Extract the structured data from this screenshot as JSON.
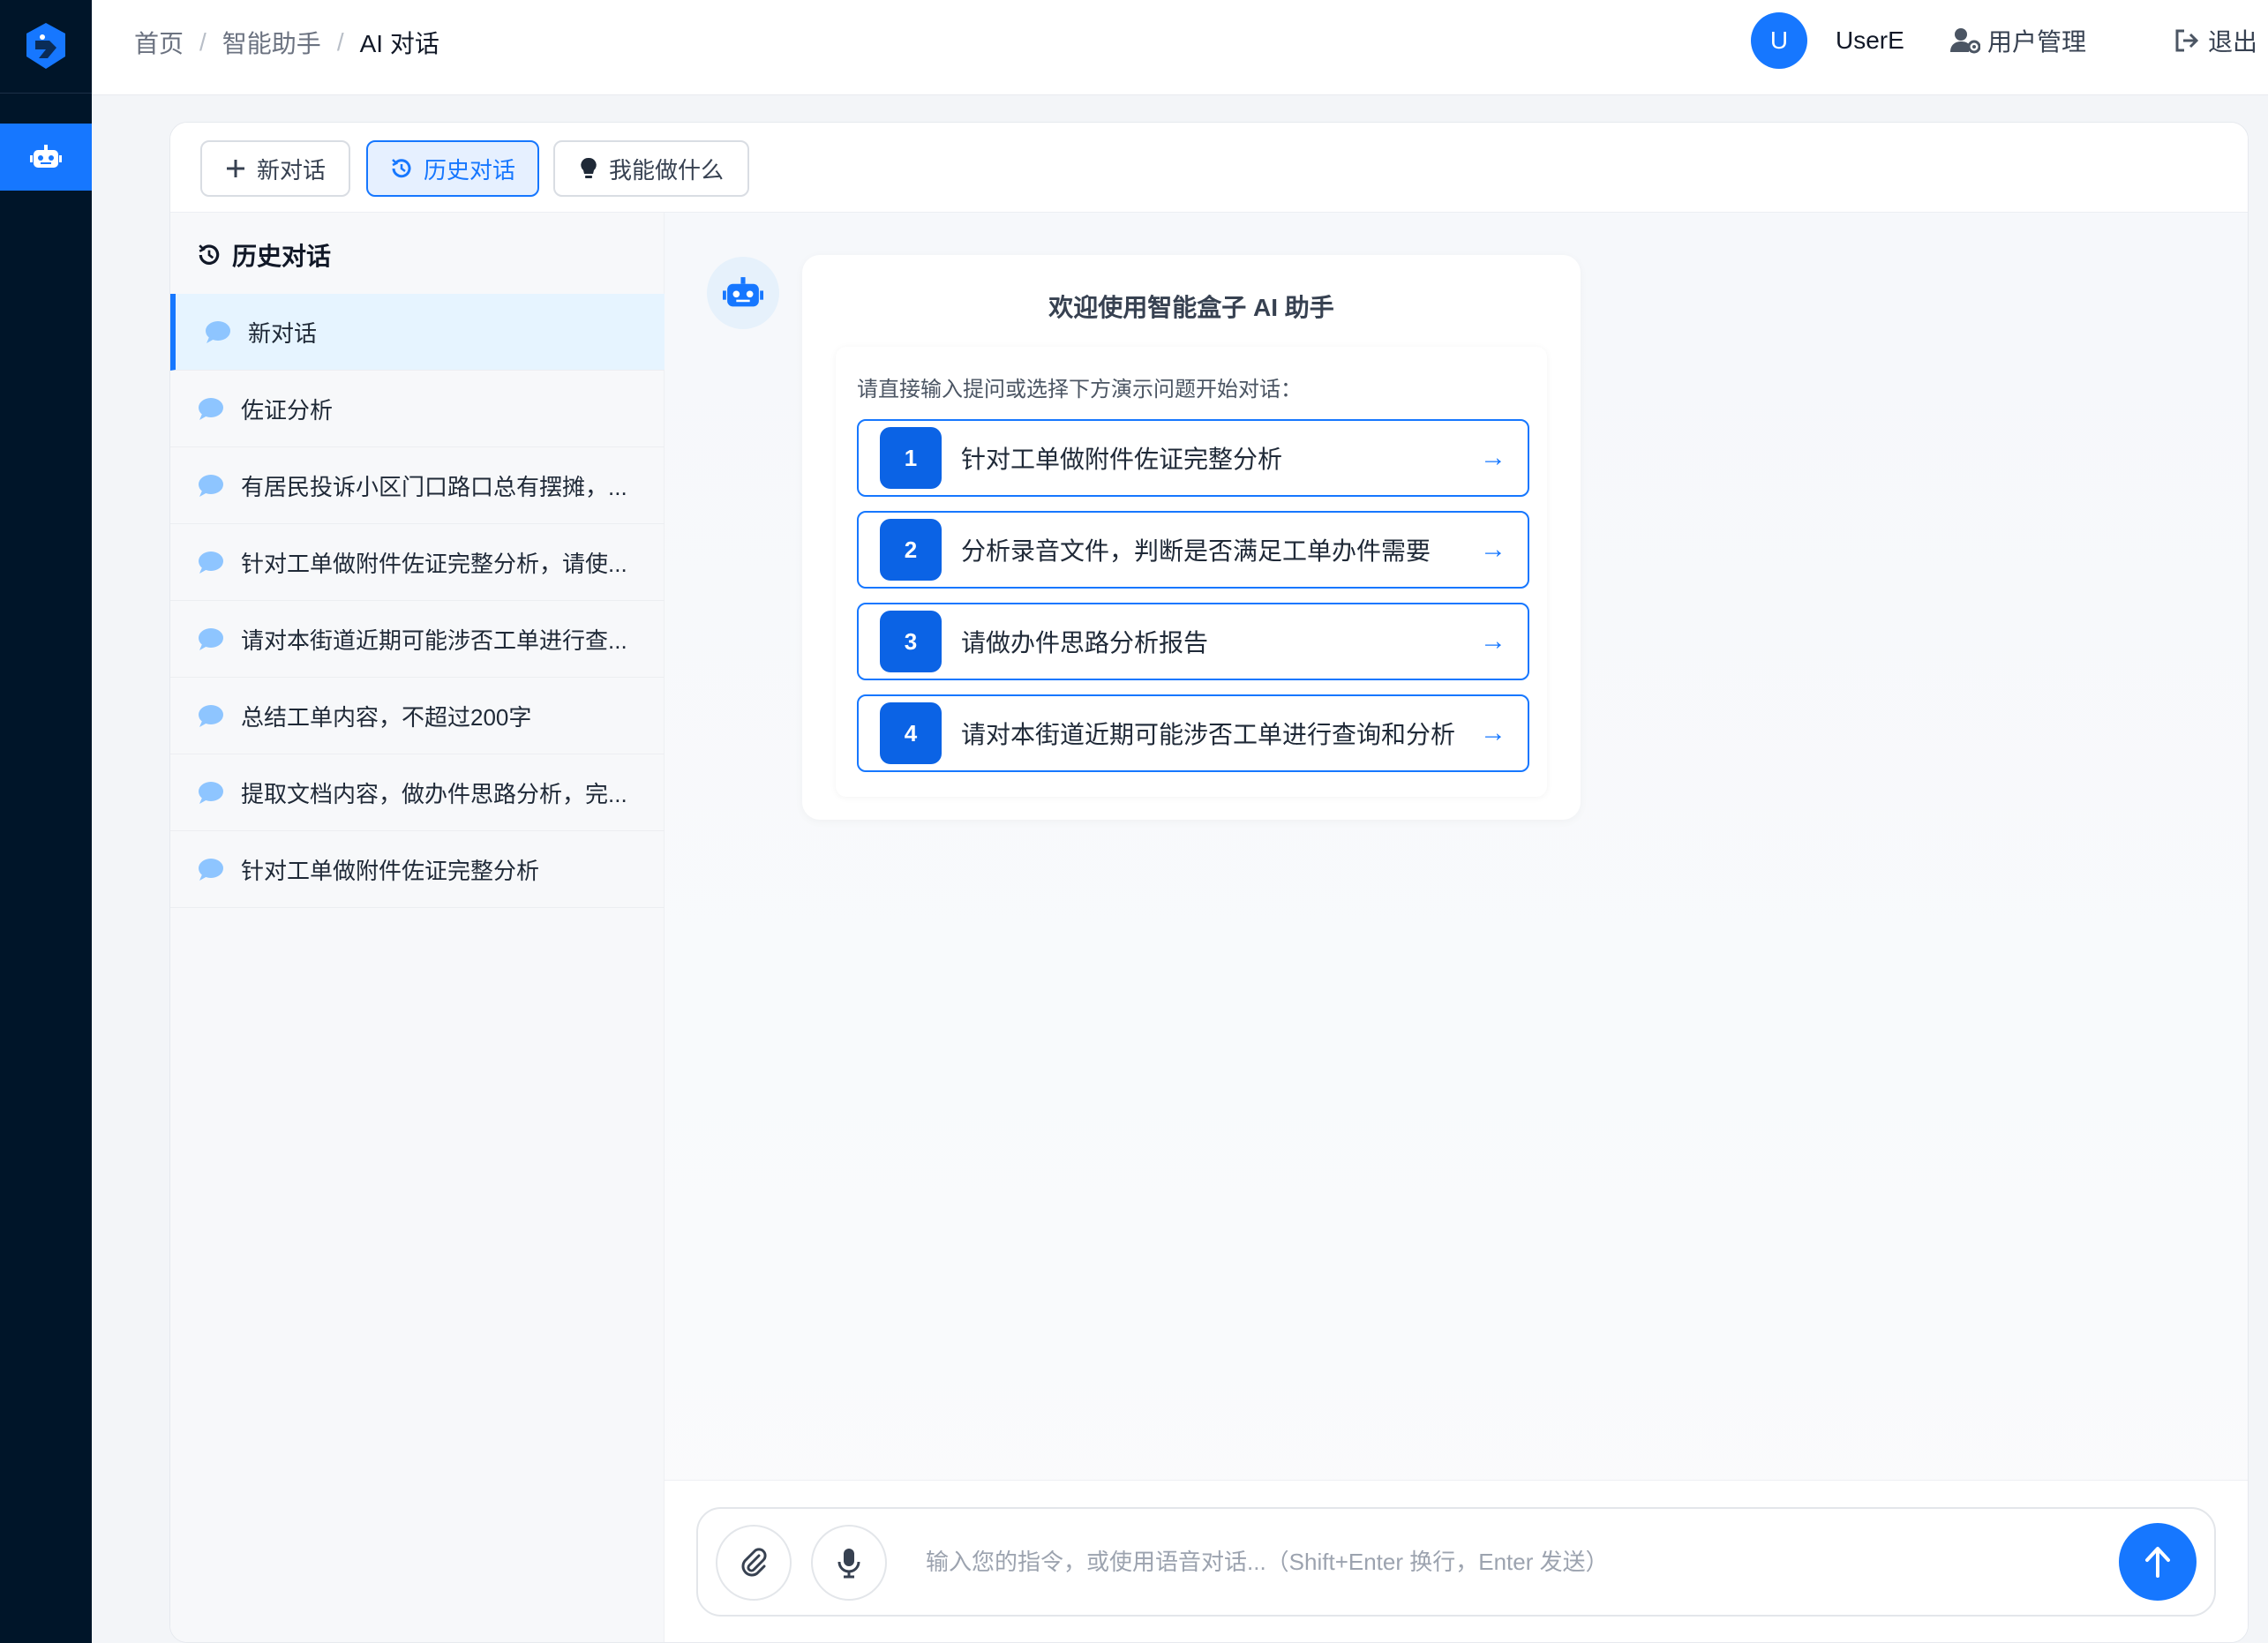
{
  "breadcrumb": [
    "首页",
    "智能助手",
    "AI 对话"
  ],
  "user": {
    "avatar_letter": "U",
    "name": "UserE"
  },
  "header": {
    "user_management": "用户管理",
    "logout": "退出"
  },
  "toolbar": {
    "new_chat": "新对话",
    "history": "历史对话",
    "capabilities": "我能做什么"
  },
  "sidebar": {
    "title": "历史对话",
    "items": [
      "新对话",
      "佐证分析",
      "有居民投诉小区门口路口总有摆摊，...",
      "针对工单做附件佐证完整分析，请使...",
      "请对本街道近期可能涉否工单进行查...",
      "总结工单内容，不超过200字",
      "提取文档内容，做办件思路分析，完...",
      "针对工单做附件佐证完整分析"
    ]
  },
  "welcome": {
    "title": "欢迎使用智能盒子 AI 助手",
    "hint": "请直接输入提问或选择下方演示问题开始对话：",
    "questions": [
      {
        "num": "1",
        "text": "针对工单做附件佐证完整分析"
      },
      {
        "num": "2",
        "text": "分析录音文件，判断是否满足工单办件需要"
      },
      {
        "num": "3",
        "text": "请做办件思路分析报告"
      },
      {
        "num": "4",
        "text": "请对本街道近期可能涉否工单进行查询和分析"
      }
    ],
    "arrow": "→"
  },
  "composer": {
    "placeholder": "输入您的指令，或使用语音对话...（Shift+Enter 换行，Enter 发送）"
  },
  "colors": {
    "primary": "#1677ff",
    "rail": "#001529",
    "active_bg": "#e6f4ff"
  }
}
